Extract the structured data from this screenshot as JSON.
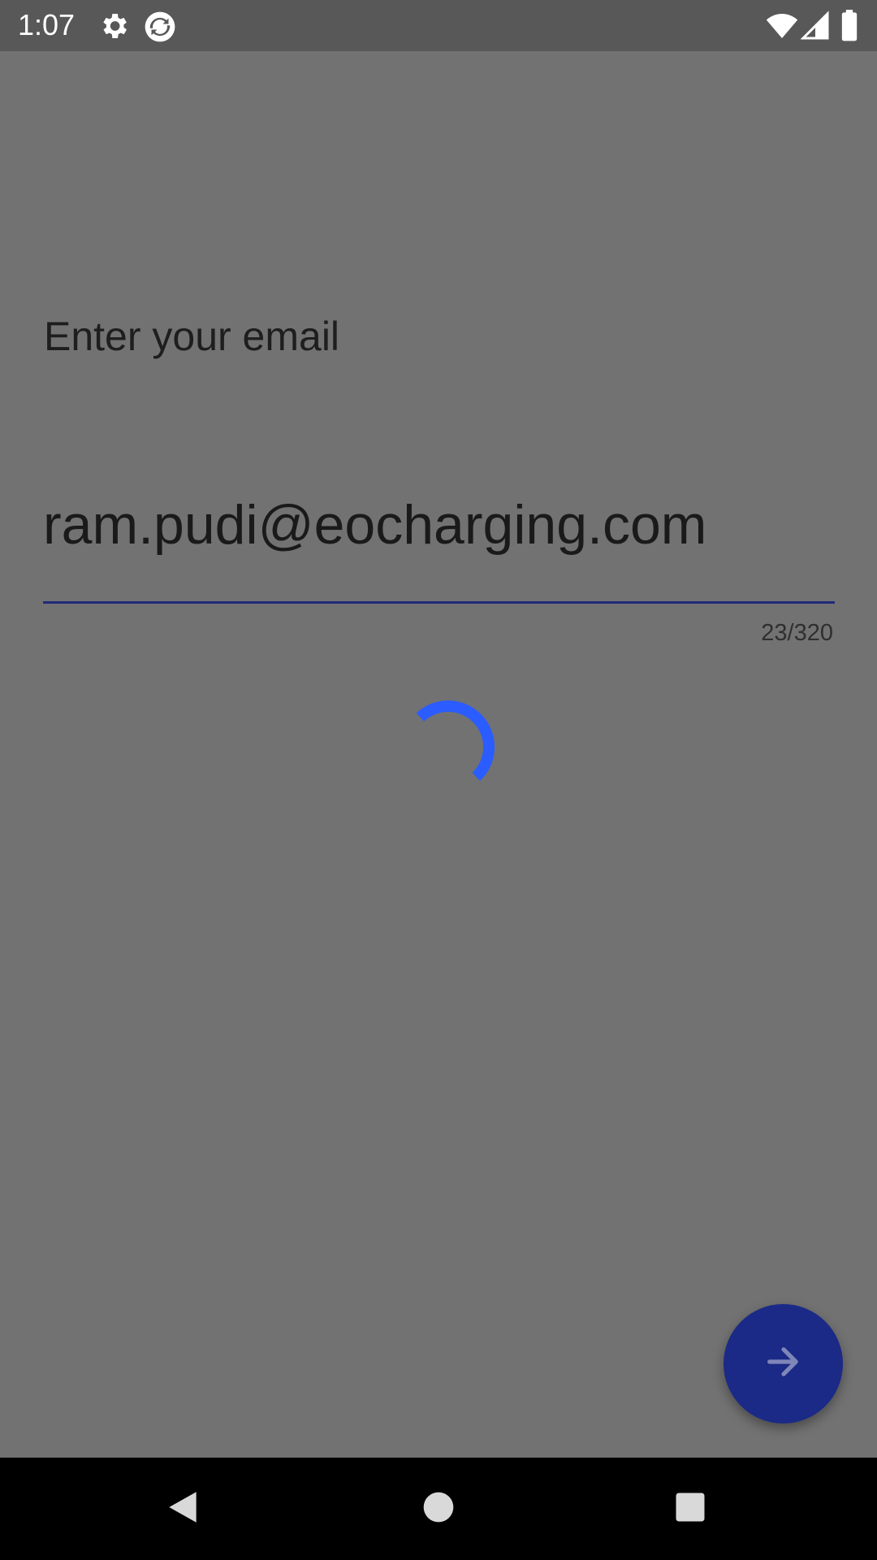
{
  "status_bar": {
    "time": "1:07",
    "icons": [
      "settings-icon",
      "sync-app-icon",
      "wifi-icon",
      "cell-signal-icon",
      "battery-icon"
    ]
  },
  "screen": {
    "prompt": "Enter your email",
    "email_value": "ram.pudi@eocharging.com",
    "char_counter": "23/320",
    "loading": true,
    "next_button_icon": "arrow-right-icon"
  },
  "navigation": {
    "buttons": [
      "back-icon",
      "home-icon",
      "recents-icon"
    ]
  },
  "colors": {
    "scrim_background": "#727272",
    "status_bar": "#585858",
    "accent": "#1b2a86",
    "spinner": "#2b5cff"
  }
}
